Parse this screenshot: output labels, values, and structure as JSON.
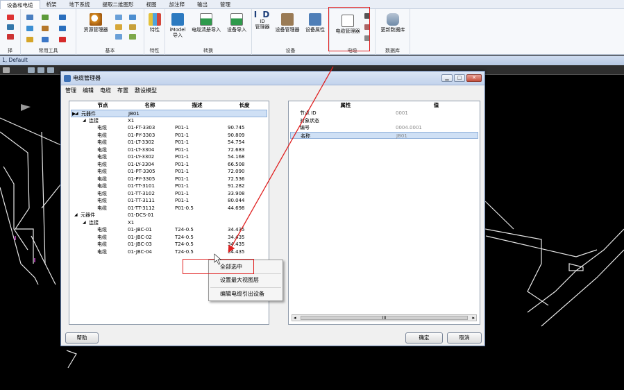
{
  "ribbon": {
    "tabs": [
      "设备和电缆",
      "桥架",
      "地下系统",
      "提取二维图形",
      "视图",
      "加注释",
      "输出",
      "管理"
    ],
    "groups": [
      {
        "label": "择"
      },
      {
        "label": "常用工具"
      },
      {
        "label": "基本"
      },
      {
        "label": "特性"
      },
      {
        "label": "转换"
      },
      {
        "label": "设备"
      },
      {
        "label": "电缆"
      },
      {
        "label": "数据库"
      }
    ],
    "buttons": {
      "resource_manager": "资源管理器",
      "properties": "特性",
      "imodel_import": "iModel\n导入",
      "cable_list_import": "电缆清册导入",
      "device_import": "设备导入",
      "id_manager": "ID\n管理器",
      "device_manager": "设备管理器",
      "device_attr": "设备属性",
      "cable_manager": "电缆管理器",
      "update_db": "更新数据库"
    },
    "id_icon_text": "I D"
  },
  "status": {
    "view_name": "1, Default"
  },
  "dialog": {
    "title": "电缆管理器",
    "menu": [
      "管理",
      "编辑",
      "电缆",
      "布置",
      "敷设模型"
    ],
    "left_headers": [
      "节点",
      "名称",
      "描述",
      "长度"
    ],
    "tree_rows": [
      {
        "node": "元器件",
        "name": "JB01",
        "desc": "",
        "len": "",
        "indent": 0,
        "arrow": "◢",
        "selected": true,
        "pointer": "▶"
      },
      {
        "node": "连接",
        "name": "X1",
        "desc": "",
        "len": "",
        "indent": 1,
        "arrow": "◢"
      },
      {
        "node": "电缆",
        "name": "01-FT-3303",
        "desc": "P01-1",
        "len": "90.745",
        "indent": 2
      },
      {
        "node": "电缆",
        "name": "01-PY-3303",
        "desc": "P01-1",
        "len": "90.809",
        "indent": 2
      },
      {
        "node": "电缆",
        "name": "01-LT-3302",
        "desc": "P01-1",
        "len": "54.754",
        "indent": 2
      },
      {
        "node": "电缆",
        "name": "01-LT-3304",
        "desc": "P01-1",
        "len": "72.683",
        "indent": 2
      },
      {
        "node": "电缆",
        "name": "01-LY-3302",
        "desc": "P01-1",
        "len": "54.168",
        "indent": 2
      },
      {
        "node": "电缆",
        "name": "01-LY-3304",
        "desc": "P01-1",
        "len": "66.508",
        "indent": 2
      },
      {
        "node": "电缆",
        "name": "01-PT-3305",
        "desc": "P01-1",
        "len": "72.090",
        "indent": 2
      },
      {
        "node": "电缆",
        "name": "01-PY-3305",
        "desc": "P01-1",
        "len": "72.536",
        "indent": 2
      },
      {
        "node": "电缆",
        "name": "01-TT-3101",
        "desc": "P01-1",
        "len": "91.282",
        "indent": 2
      },
      {
        "node": "电缆",
        "name": "01-TT-3102",
        "desc": "P01-1",
        "len": "33.908",
        "indent": 2
      },
      {
        "node": "电缆",
        "name": "01-TT-3111",
        "desc": "P01-1",
        "len": "80.044",
        "indent": 2
      },
      {
        "node": "电缆",
        "name": "01-TT-3112",
        "desc": "P01-0.5",
        "len": "44.698",
        "indent": 2
      },
      {
        "node": "元器件",
        "name": "01-DCS-01",
        "desc": "",
        "len": "",
        "indent": 0,
        "arrow": "◢"
      },
      {
        "node": "连接",
        "name": "X1",
        "desc": "",
        "len": "",
        "indent": 1,
        "arrow": "◢"
      },
      {
        "node": "电缆",
        "name": "01-JBC-01",
        "desc": "T24-0.5",
        "len": "34.435",
        "indent": 2
      },
      {
        "node": "电缆",
        "name": "01-JBC-02",
        "desc": "T24-0.5",
        "len": "34.435",
        "indent": 2
      },
      {
        "node": "电缆",
        "name": "01-JBC-03",
        "desc": "T24-0.5",
        "len": "34.435",
        "indent": 2
      },
      {
        "node": "电缆",
        "name": "01-JBC-04",
        "desc": "T24-0.5",
        "len": "34.435",
        "indent": 2
      }
    ],
    "right_headers": [
      "属性",
      "值"
    ],
    "prop_rows": [
      {
        "name": "节点 ID",
        "value": "0001"
      },
      {
        "name": "对象状态",
        "value": ""
      },
      {
        "name": "编号",
        "value": "0004.0001"
      },
      {
        "name": "名称",
        "value": "JB01",
        "selected": true
      }
    ],
    "scroll_mid": "III",
    "buttons": {
      "help": "帮助",
      "ok": "确定",
      "cancel": "取消"
    }
  },
  "context_menu": [
    "全部选中",
    "设置最大视图层",
    "编辑电缆引出设备"
  ],
  "colors": {
    "highlight": "#e02020",
    "selection": "#cfe0f5"
  }
}
